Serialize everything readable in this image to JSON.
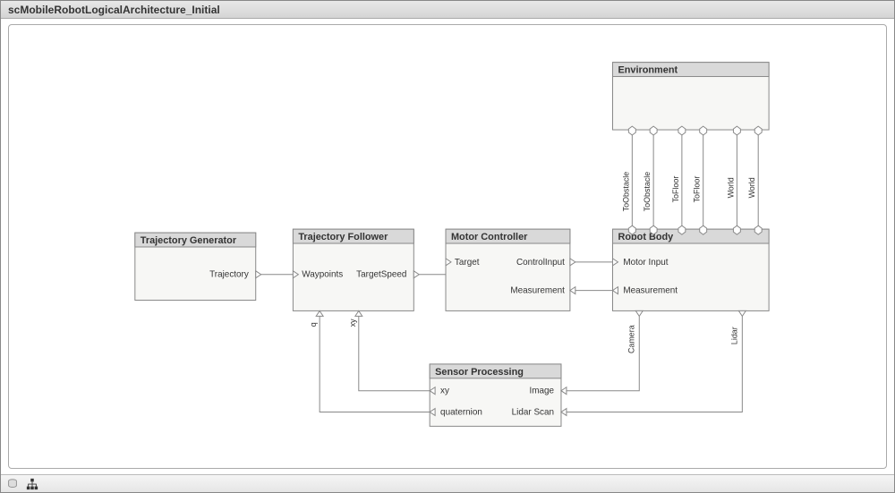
{
  "title": "scMobileRobotLogicalArchitecture_Initial",
  "blocks": {
    "trajGen": {
      "title": "Trajectory Generator",
      "ports": {
        "trajectory": "Trajectory"
      }
    },
    "trajFoll": {
      "title": "Trajectory Follower",
      "ports": {
        "waypoints": "Waypoints",
        "targetSpeed": "TargetSpeed",
        "q": "q",
        "xy": "xy"
      }
    },
    "motorCtrl": {
      "title": "Motor Controller",
      "ports": {
        "target": "Target",
        "controlInput": "ControlInput",
        "measurement": "Measurement"
      }
    },
    "robotBody": {
      "title": "Robot Body",
      "ports": {
        "motorInput": "Motor Input",
        "measurement": "Measurement",
        "camera": "Camera",
        "lidar": "Lidar"
      }
    },
    "environment": {
      "title": "Environment",
      "ports": {
        "toObstacle1": "ToObstacle",
        "toObstacle2": "ToObstacle",
        "toFloor1": "ToFloor",
        "toFloor2": "ToFloor",
        "world1": "World",
        "world2": "World"
      }
    },
    "sensorProc": {
      "title": "Sensor Processing",
      "ports": {
        "xy": "xy",
        "quaternion": "quaternion",
        "image": "Image",
        "lidarScan": "Lidar Scan"
      }
    }
  }
}
